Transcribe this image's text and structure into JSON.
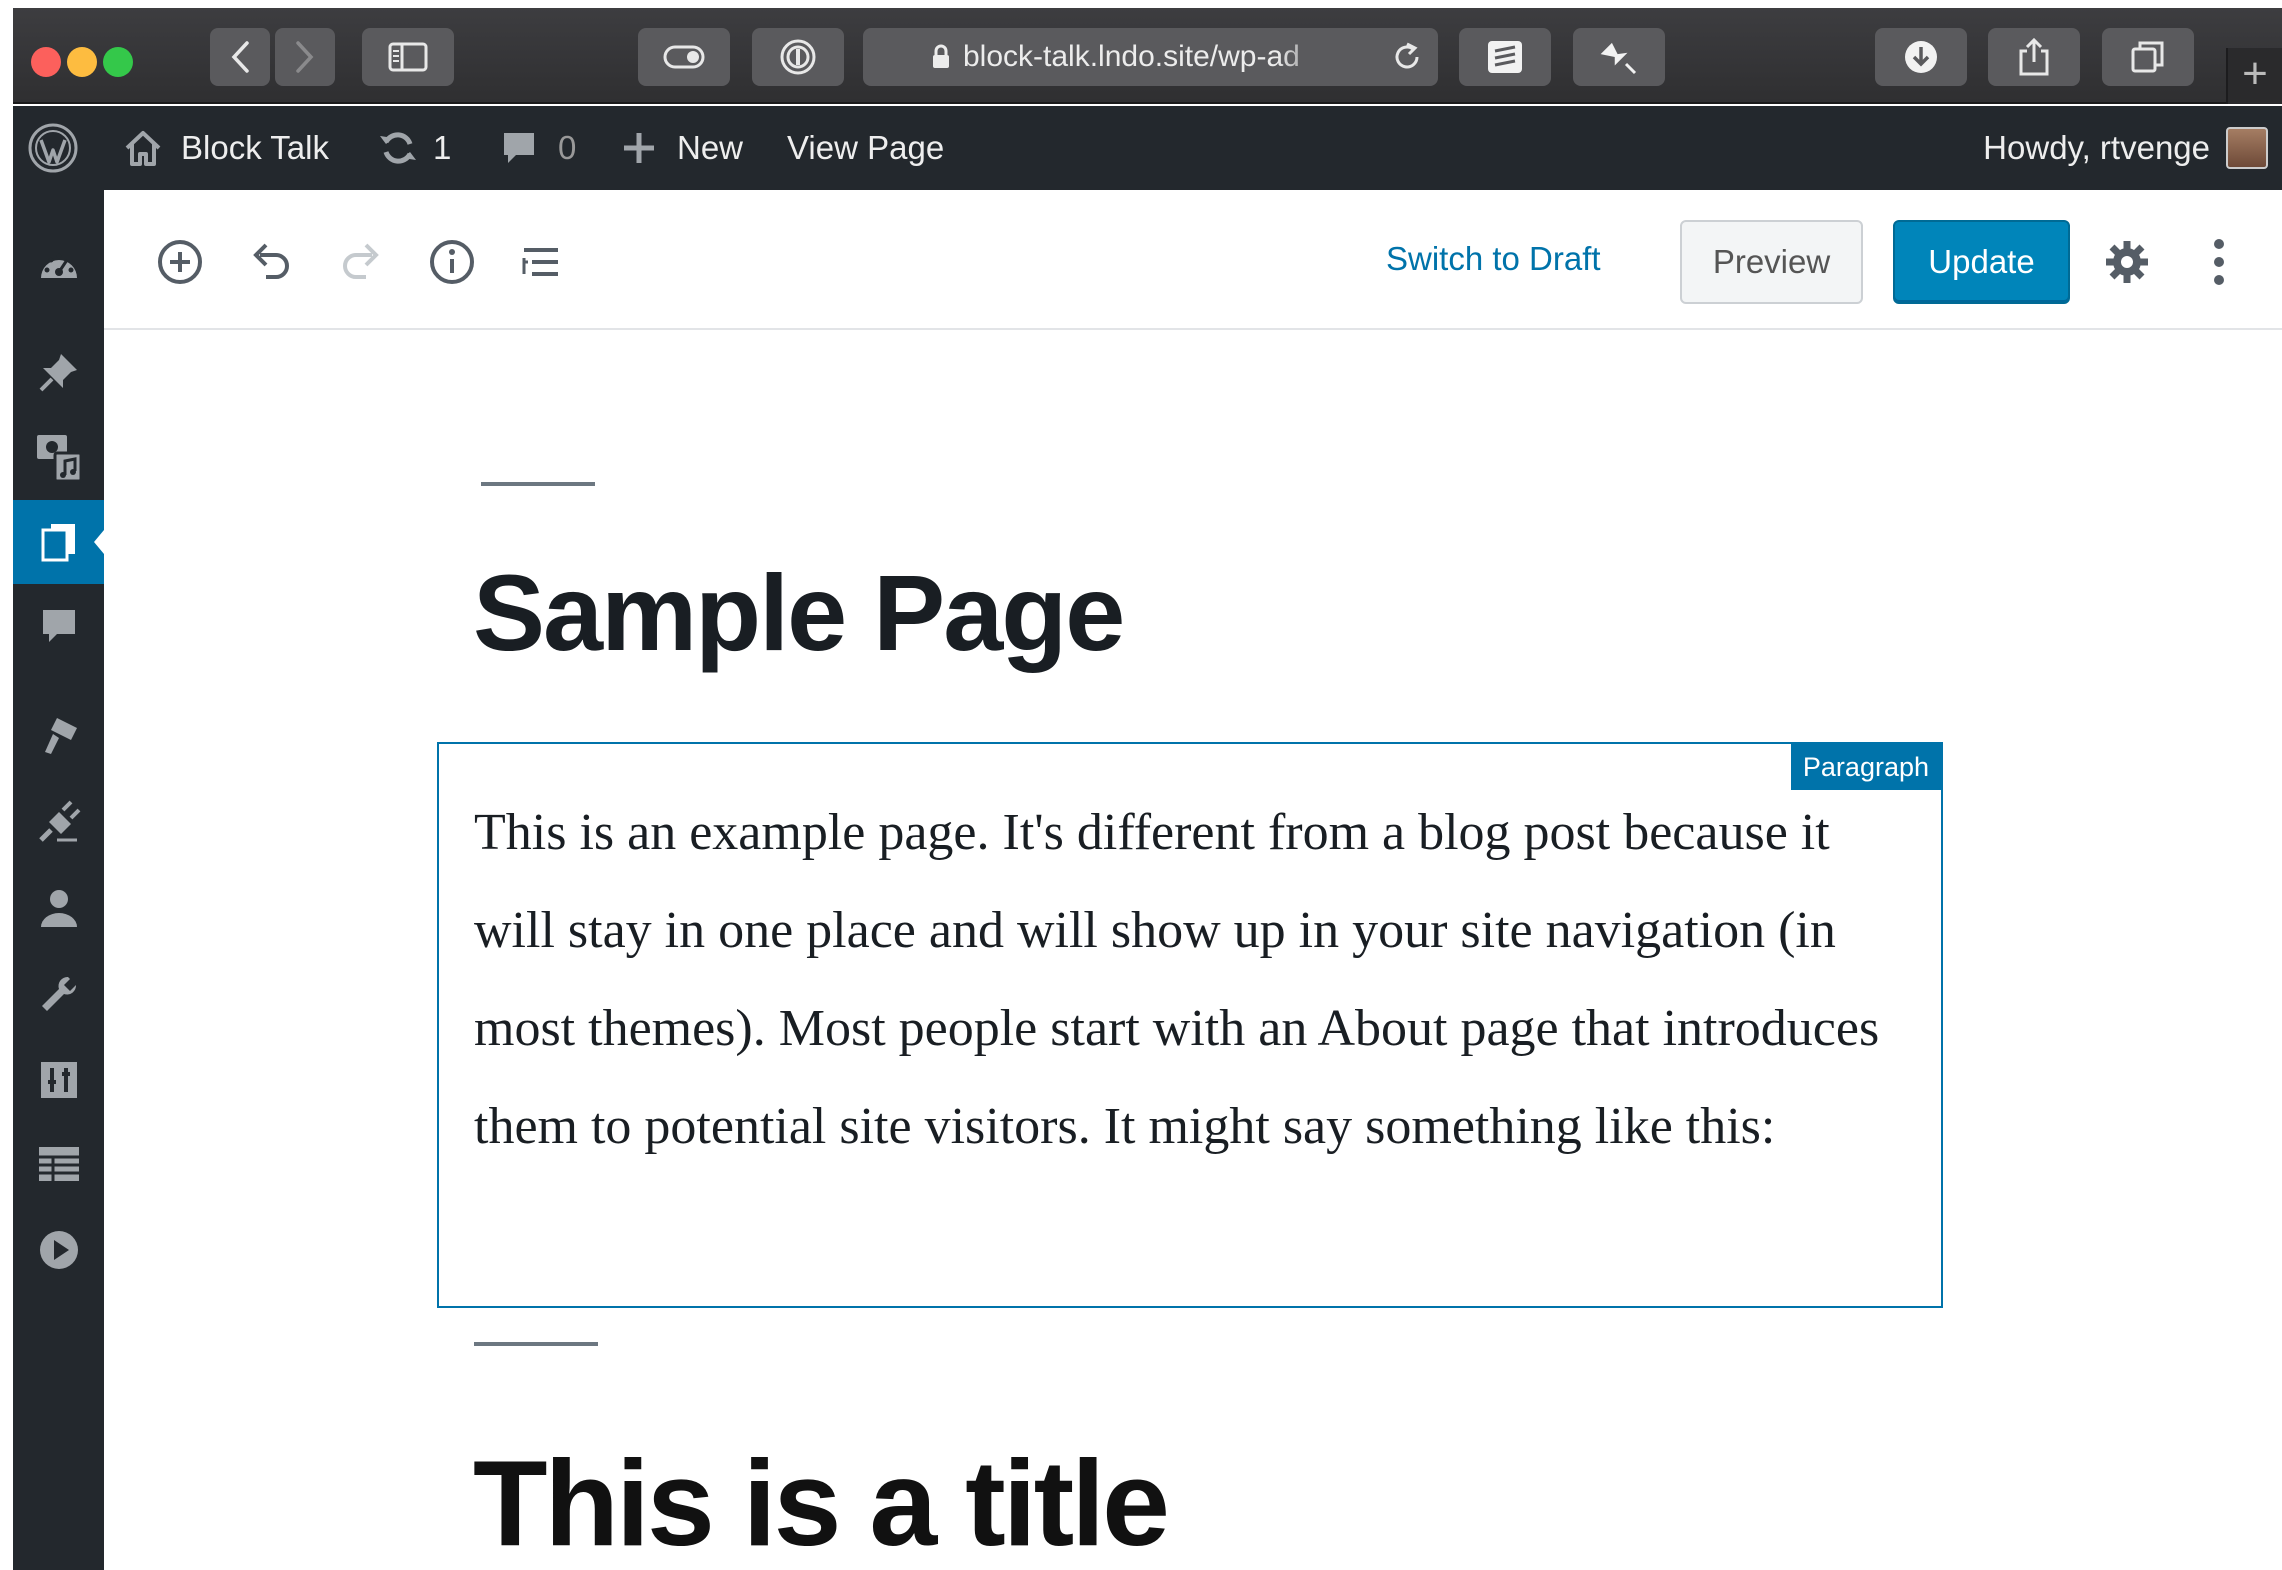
{
  "browser": {
    "url": "block-talk.lndo.site/wp-ad"
  },
  "admin_bar": {
    "site_name": "Block Talk",
    "updates_count": "1",
    "comments_count": "0",
    "new_label": "New",
    "view_page_label": "View Page",
    "howdy": "Howdy, rtvenge"
  },
  "sidebar": {
    "active_item": "pages",
    "icons": [
      "dashboard-icon",
      "pin-icon",
      "media-icon",
      "pages-icon",
      "comments-icon",
      "appearance-icon",
      "plugins-icon",
      "users-icon",
      "tools-icon",
      "settings-icon",
      "table-icon",
      "play-icon"
    ]
  },
  "editor_toolbar": {
    "switch_to_draft": "Switch to Draft",
    "preview": "Preview",
    "update": "Update"
  },
  "content": {
    "title": "Sample Page",
    "block_label": "Paragraph",
    "paragraph": "This is an example page. It's different from a blog post because it will stay in one place and will show up in your site navigation (in most themes). Most people start with an About page that introduces them to potential site visitors. It might say something like this:",
    "heading": "This is a title"
  },
  "colors": {
    "admin_bar": "#23282d",
    "accent": "#0073aa",
    "update_button": "#0085ba"
  }
}
